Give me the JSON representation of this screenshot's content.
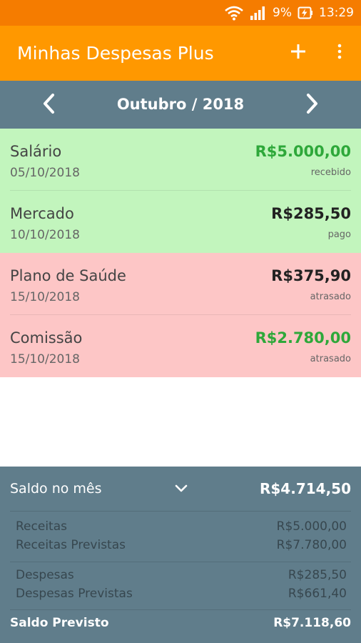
{
  "status_bar": {
    "battery": "9%",
    "time": "13:29",
    "icons": [
      "wifi-icon",
      "signal-icon",
      "battery-charging-icon"
    ]
  },
  "app_bar": {
    "title": "Minhas Despesas Plus",
    "actions": [
      "add-icon",
      "more-vert-icon"
    ]
  },
  "month_nav": {
    "label": "Outubro / 2018"
  },
  "transactions": [
    {
      "name": "Salário",
      "date": "05/10/2018",
      "amount": "R$5.000,00",
      "status": "recebido",
      "row_color": "#c2f5bd",
      "amount_color": "#2ea83a"
    },
    {
      "name": "Mercado",
      "date": "10/10/2018",
      "amount": "R$285,50",
      "status": "pago",
      "row_color": "#c2f5bd",
      "amount_color": "#222222"
    },
    {
      "name": "Plano de Saúde",
      "date": "15/10/2018",
      "amount": "R$375,90",
      "status": "atrasado",
      "row_color": "#fdc6c6",
      "amount_color": "#222222"
    },
    {
      "name": "Comissão",
      "date": "15/10/2018",
      "amount": "R$2.780,00",
      "status": "atrasado",
      "row_color": "#fdc6c6",
      "amount_color": "#2ea83a"
    }
  ],
  "summary": {
    "header_label": "Saldo no mês",
    "header_value": "R$4.714,50",
    "rows": [
      {
        "label": "Receitas",
        "value": "R$5.000,00"
      },
      {
        "label": "Receitas Previstas",
        "value": "R$7.780,00"
      },
      {
        "label": "Despesas",
        "value": "R$285,50"
      },
      {
        "label": "Despesas Previstas",
        "value": "R$661,40"
      }
    ],
    "footer_label": "Saldo Previsto",
    "footer_value": "R$7.118,60"
  },
  "colors": {
    "status_bar": "#f57c00",
    "app_bar": "#ff9800",
    "month_bar": "#607d8b",
    "income_green": "#2ea83a"
  }
}
